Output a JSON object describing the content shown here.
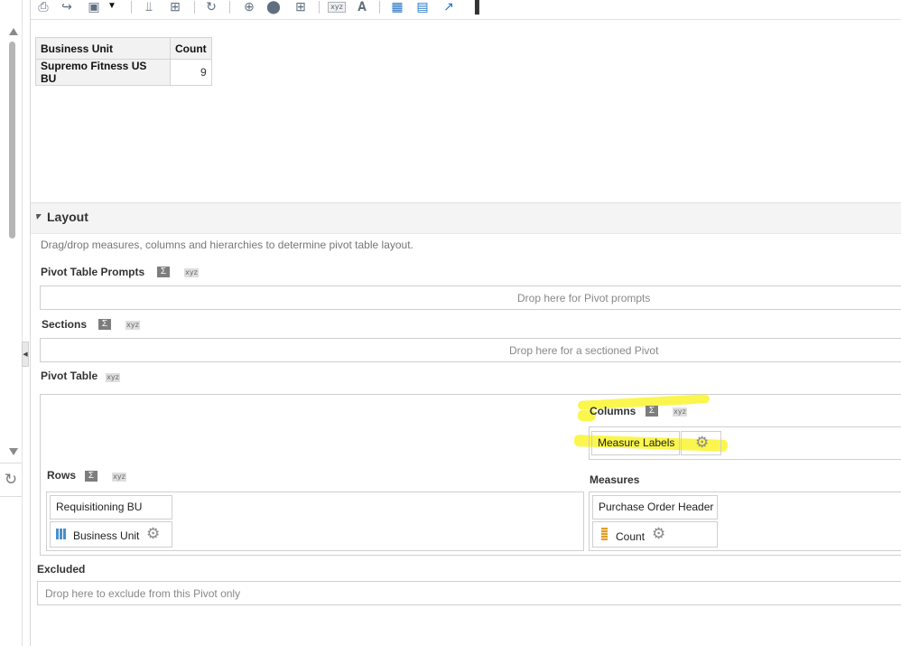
{
  "toolbar": {
    "icons": [
      "print-icon",
      "export-icon",
      "view-icon",
      "dropdown-icon",
      "filter-icon",
      "selector-icon",
      "refresh-icon",
      "insert-icon",
      "group-icon",
      "calc-icon",
      "xyz-icon",
      "text-icon",
      "pivot-icon",
      "table-icon",
      "graph-icon",
      "bar-chart-icon"
    ],
    "xyz_label": "xyz"
  },
  "result_table": {
    "headers": [
      "Business Unit",
      "Count"
    ],
    "rows": [
      [
        "Supremo Fitness US BU",
        "9"
      ]
    ]
  },
  "layout": {
    "title": "Layout",
    "help_text": "Drag/drop measures, columns and hierarchies to determine pivot table layout.",
    "sigma": "Σ",
    "xyz": "xyz",
    "pivot_prompts": {
      "label": "Pivot Table Prompts",
      "drop_text": "Drop here for Pivot prompts"
    },
    "sections": {
      "label": "Sections",
      "drop_text": "Drop here for a sectioned Pivot"
    },
    "pivot_table": {
      "label": "Pivot Table",
      "columns": {
        "label": "Columns",
        "items": [
          "Measure Labels"
        ]
      },
      "rows": {
        "label": "Rows",
        "folder": "Requisitioning BU",
        "items": [
          "Business Unit"
        ]
      },
      "measures": {
        "label": "Measures",
        "folder": "Purchase Order Header",
        "items": [
          "Count"
        ]
      }
    },
    "excluded": {
      "label": "Excluded",
      "drop_text": "Drop here to exclude from this Pivot only"
    }
  },
  "highlight_color": "#f9f53a"
}
